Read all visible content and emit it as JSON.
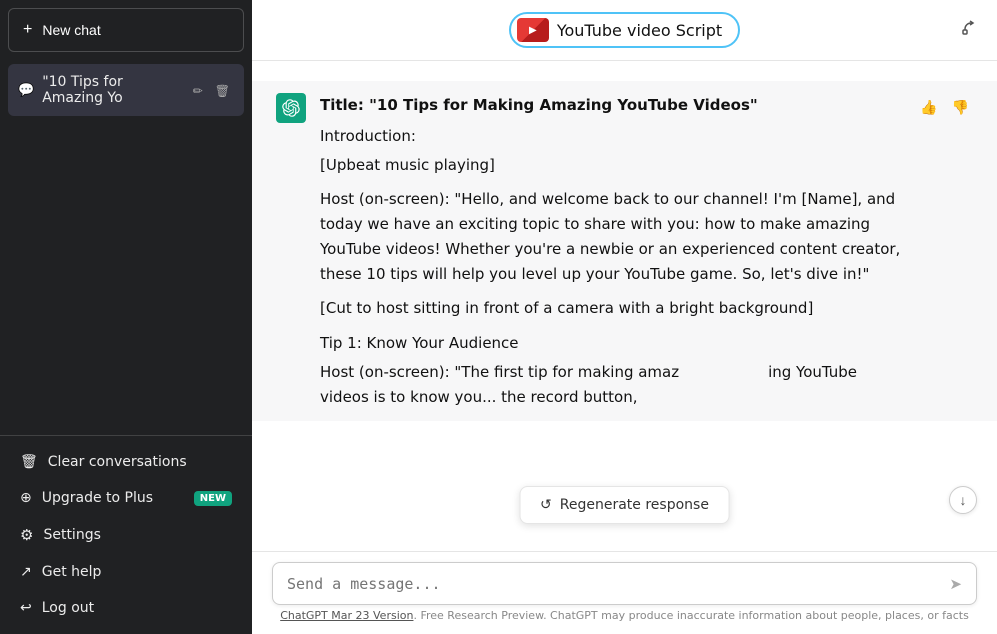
{
  "sidebar": {
    "new_chat_label": "New chat",
    "new_chat_icon": "plus-icon",
    "chat_items": [
      {
        "id": "chat-1",
        "label": "\"10 Tips for Amazing Yo",
        "icon": "chat-icon"
      }
    ],
    "bottom_items": [
      {
        "id": "clear",
        "label": "Clear conversations",
        "icon": "trash-icon"
      },
      {
        "id": "upgrade",
        "label": "Upgrade to Plus",
        "icon": "user-icon",
        "badge": "NEW"
      },
      {
        "id": "settings",
        "label": "Settings",
        "icon": "settings-icon"
      },
      {
        "id": "help",
        "label": "Get help",
        "icon": "help-icon"
      },
      {
        "id": "logout",
        "label": "Log out",
        "icon": "logout-icon"
      }
    ]
  },
  "header": {
    "title": "YouTube video Script",
    "share_label": "share",
    "border_color": "#4fc3f7"
  },
  "chat": {
    "messages": [
      {
        "role": "assistant",
        "title": "Title: \"10 Tips for Making Amazing YouTube Videos\"",
        "paragraphs": [
          "Introduction:",
          "[Upbeat music playing]",
          "Host (on-screen): \"Hello, and welcome back to our channel! I'm [Name], and today we have an exciting topic to share with you: how to make amazing YouTube videos! Whether you're a newbie or an experienced content creator, these 10 tips will help you level up your YouTube game. So, let's dive in!\"",
          "[Cut to host sitting in front of a camera with a bright background]",
          "Tip 1: Know Your Audience",
          "Host (on-screen): \"The first tip for making amazing YouTube videos is to know you... the record button,"
        ]
      }
    ],
    "regenerate_label": "Regenerate response"
  },
  "input": {
    "placeholder": "Send a message...",
    "send_icon": "send-icon"
  },
  "footer": {
    "link_text": "ChatGPT Mar 23 Version",
    "note": ". Free Research Preview. ChatGPT may produce inaccurate information about people, places, or facts"
  }
}
